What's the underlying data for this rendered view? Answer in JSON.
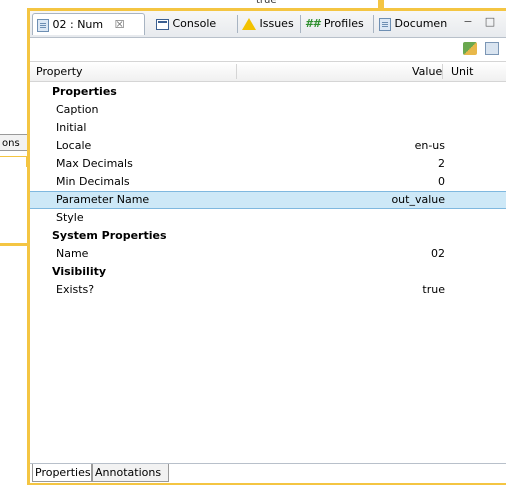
{
  "background": {
    "top_value": "true",
    "left_tab_label": "ons"
  },
  "tabs": [
    {
      "label": "02 : Num",
      "icon": "document-icon",
      "active": true
    },
    {
      "label": "Console",
      "icon": "console-icon"
    },
    {
      "label": "Issues",
      "icon": "warning-icon"
    },
    {
      "label": "Profiles",
      "icon": "hash-icon",
      "icon_text": "##"
    },
    {
      "label": "Documen",
      "icon": "document-icon"
    }
  ],
  "tab_close_glyph": "☒",
  "window_buttons": {
    "minimize": "−",
    "maximize": "□"
  },
  "columns": {
    "property": "Property",
    "value": "Value",
    "unit": "Unit"
  },
  "rows": [
    {
      "name": "Properties",
      "value": "",
      "group": true
    },
    {
      "name": "Caption",
      "value": ""
    },
    {
      "name": "Initial",
      "value": ""
    },
    {
      "name": "Locale",
      "value": "en-us"
    },
    {
      "name": "Max Decimals",
      "value": "2"
    },
    {
      "name": "Min Decimals",
      "value": "0"
    },
    {
      "name": "Parameter Name",
      "value": "out_value",
      "selected": true
    },
    {
      "name": "Style",
      "value": ""
    },
    {
      "name": "System Properties",
      "value": "",
      "group": true
    },
    {
      "name": "Name",
      "value": "02"
    },
    {
      "name": "Visibility",
      "value": "",
      "group": true
    },
    {
      "name": "Exists?",
      "value": "true"
    }
  ],
  "bottom_tabs": [
    {
      "label": "Properties",
      "active": true
    },
    {
      "label": "Annotations"
    }
  ],
  "colors": {
    "highlight": "#f4c542",
    "selection": "#cde8f7"
  }
}
